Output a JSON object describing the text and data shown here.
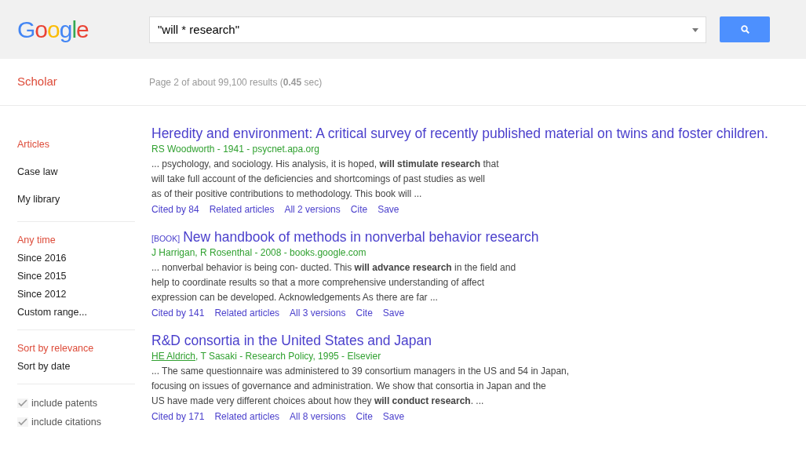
{
  "header": {
    "logo": "Google",
    "search": {
      "value": "\"will * research\""
    }
  },
  "subheader": {
    "section": "Scholar",
    "stats": "Page 2 of about 99,100 results (**0.45** sec)"
  },
  "sidebar": {
    "groups": [
      {
        "items": [
          {
            "label": "Articles",
            "selected": true
          },
          {
            "label": "Case law",
            "selected": false
          },
          {
            "label": "My library",
            "selected": false
          }
        ]
      },
      {
        "items": [
          {
            "label": "Any time",
            "selected": true
          },
          {
            "label": "Since 2016",
            "selected": false
          },
          {
            "label": "Since 2015",
            "selected": false
          },
          {
            "label": "Since 2012",
            "selected": false
          },
          {
            "label": "Custom range...",
            "selected": false
          }
        ]
      },
      {
        "items": [
          {
            "label": "Sort by relevance",
            "selected": true
          },
          {
            "label": "Sort by date",
            "selected": false
          }
        ]
      }
    ],
    "checkboxes": [
      {
        "label": "include patents",
        "checked": true
      },
      {
        "label": "include citations",
        "checked": true
      }
    ]
  },
  "results": [
    {
      "title": "Heredity and environment: A critical survey of recently published material on twins and foster children.",
      "byline": "RS Woodworth - 1941 - psycnet.apa.org",
      "snippet": [
        "... psychology, and sociology. His analysis, it is hoped, **will stimulate research** that",
        "will take full account of the deficiencies and shortcomings of past studies as well",
        "as of their positive contributions to methodology. This book will ..."
      ],
      "links": [
        "Cited by 84",
        "Related articles",
        "All 2 versions",
        "Cite",
        "Save"
      ]
    },
    {
      "tag": "[BOOK]",
      "title": "New handbook of methods in nonverbal behavior research",
      "byline": "J Harrigan, R Rosenthal - 2008 - books.google.com",
      "snippet": [
        "... nonverbal behavior is being con- ducted. This **will advance research** in the field and",
        "help to coordinate results so that a more comprehensive understanding of affect",
        "expression can be developed. Acknowledgements As there are far ..."
      ],
      "links": [
        "Cited by 141",
        "Related articles",
        "All 3 versions",
        "Cite",
        "Save"
      ]
    },
    {
      "title": "R&D consortia in the United States and Japan",
      "author_link": "HE Aldrich",
      "byline": ", T Sasaki - Research Policy, 1995 - Elsevier",
      "snippet": [
        "... The same questionnaire was administered to 39 consortium managers in the US and 54 in Japan,",
        "focusing on issues of governance and administration. We show that consortia in Japan and the",
        "US have made very different choices about how they **will conduct research**. ..."
      ],
      "links": [
        "Cited by 171",
        "Related articles",
        "All 8 versions",
        "Cite",
        "Save"
      ]
    }
  ]
}
